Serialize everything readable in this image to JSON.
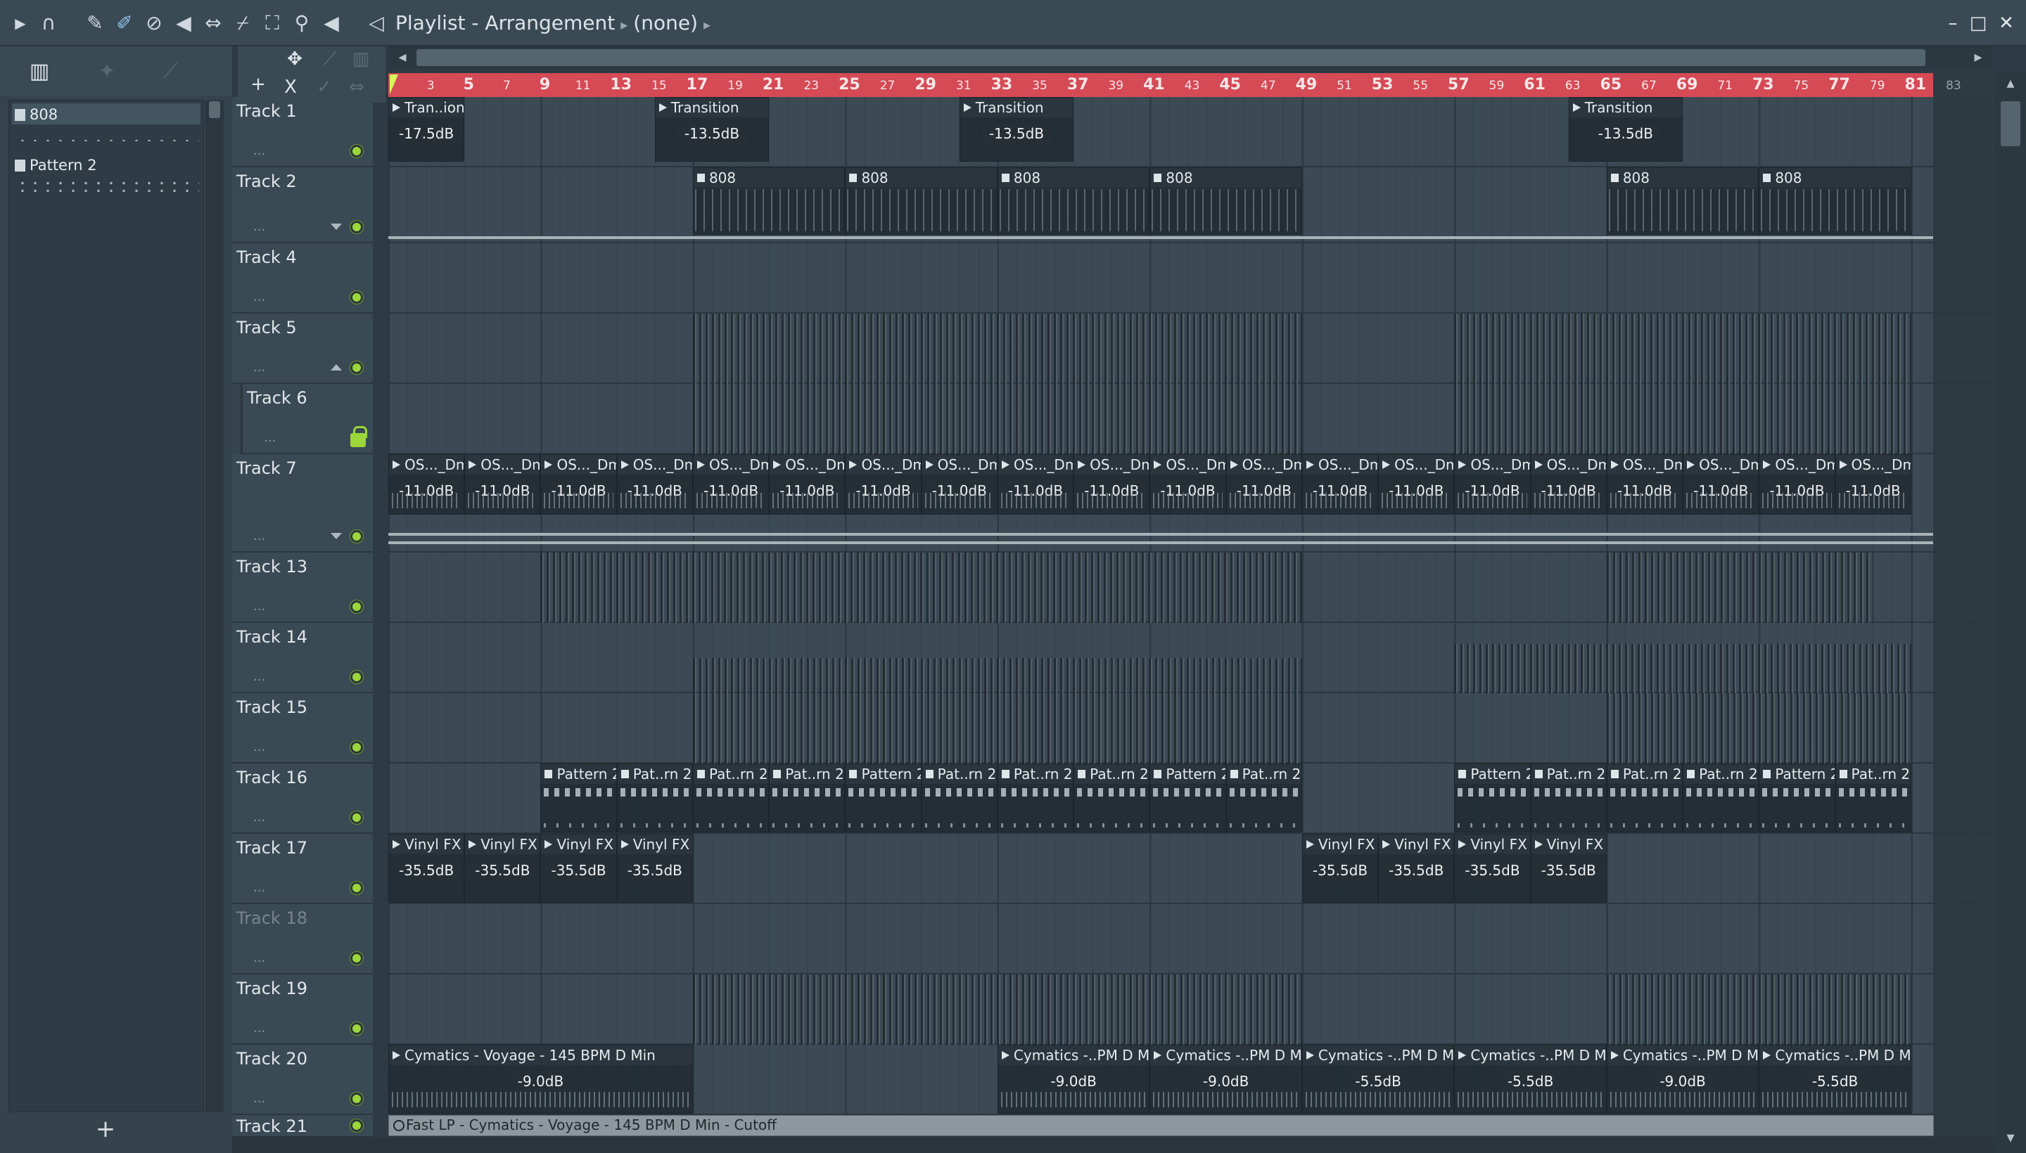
{
  "toolbar": {
    "title": "Playlist - Arrangement",
    "selection": "(none)",
    "icons": [
      "play-arrow-icon",
      "magnet-icon",
      "pencil-icon",
      "paint-icon",
      "delete-icon",
      "mute-icon",
      "slip-icon",
      "slice-icon",
      "select-icon",
      "zoom-icon",
      "playback-icon",
      "speaker-icon"
    ]
  },
  "browser": {
    "patterns": [
      {
        "name": "808",
        "selected": true
      },
      {
        "name": "Pattern 2",
        "selected": false
      }
    ],
    "add_label": "+"
  },
  "header_tools": {
    "add_label": "+",
    "close_label": "X"
  },
  "ruler": {
    "bars": [
      "3",
      "5",
      "7",
      "9",
      "11",
      "13",
      "15",
      "17",
      "19",
      "21",
      "23",
      "25",
      "27",
      "29",
      "31",
      "33",
      "35",
      "37",
      "39",
      "41",
      "43",
      "45",
      "47",
      "49",
      "51",
      "53",
      "55",
      "57",
      "59",
      "61",
      "63",
      "65",
      "67",
      "69",
      "71",
      "73",
      "75",
      "77",
      "79",
      "81",
      "83"
    ]
  },
  "tracks": [
    {
      "name": "Track 1"
    },
    {
      "name": "Track 2"
    },
    {
      "name": "Track 4"
    },
    {
      "name": "Track 5"
    },
    {
      "name": "Track 6"
    },
    {
      "name": "Track 7"
    },
    {
      "name": "Track 13"
    },
    {
      "name": "Track 14"
    },
    {
      "name": "Track 15"
    },
    {
      "name": "Track 16"
    },
    {
      "name": "Track 17"
    },
    {
      "name": "Track 18"
    },
    {
      "name": "Track 19"
    },
    {
      "name": "Track 20"
    },
    {
      "name": "Track 21"
    }
  ],
  "clips": {
    "transition_short": "Tran..ion",
    "transition": "Transition",
    "vol_t1": "-17.5dB",
    "vol_t2": "-13.5dB",
    "pattern_808": "808",
    "os": "OS..._Dm",
    "vol_os": "-11.0dB",
    "pattern2": "Pattern 2",
    "pattern2_short": "Pat..rn 2",
    "vinyl": "Vinyl FX",
    "vol_vinyl": "-35.5dB",
    "cymatics_full": "Cymatics - Voyage - 145 BPM D Min",
    "cymatics_short": "Cymatics -..PM D Min",
    "vol_cym_a": "-9.0dB",
    "vol_cym_b": "-5.5dB",
    "automation": "Fast LP - Cymatics - Voyage - 145 BPM D Min - Cutoff"
  }
}
